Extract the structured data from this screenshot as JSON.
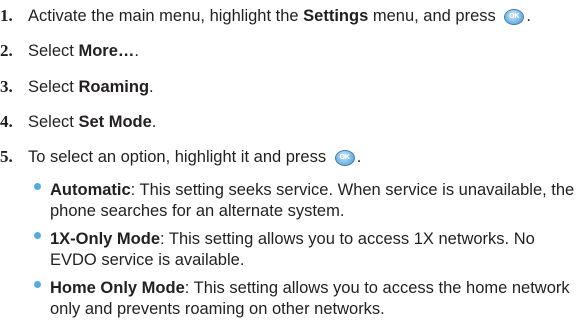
{
  "steps": [
    {
      "num": "1.",
      "pre": "Activate the main menu, highlight the ",
      "bold": "Settings",
      "post": " menu, and press ",
      "end": "."
    },
    {
      "num": "2.",
      "pre": "Select ",
      "bold": "More…",
      "post": "."
    },
    {
      "num": "3.",
      "pre": "Select ",
      "bold": "Roaming",
      "post": "."
    },
    {
      "num": "4.",
      "pre": "Select ",
      "bold": "Set Mode",
      "post": "."
    },
    {
      "num": "5.",
      "pre": "To select an option, highlight it and press ",
      "end": "."
    }
  ],
  "ok_icon_label": "OK",
  "options": [
    {
      "title": "Automatic",
      "desc": ": This setting seeks service. When service is unavailable, the phone searches for an alternate system."
    },
    {
      "title": "1X-Only Mode",
      "desc": ": This setting allows you to access 1X networks. No EVDO service is available."
    },
    {
      "title": "Home Only Mode",
      "desc": ": This setting allows you to access the home network only and prevents roaming on other networks."
    }
  ],
  "colors": {
    "text": "#231f20",
    "bullet": "#59a9dc",
    "ok_button": "#4f93c7"
  }
}
